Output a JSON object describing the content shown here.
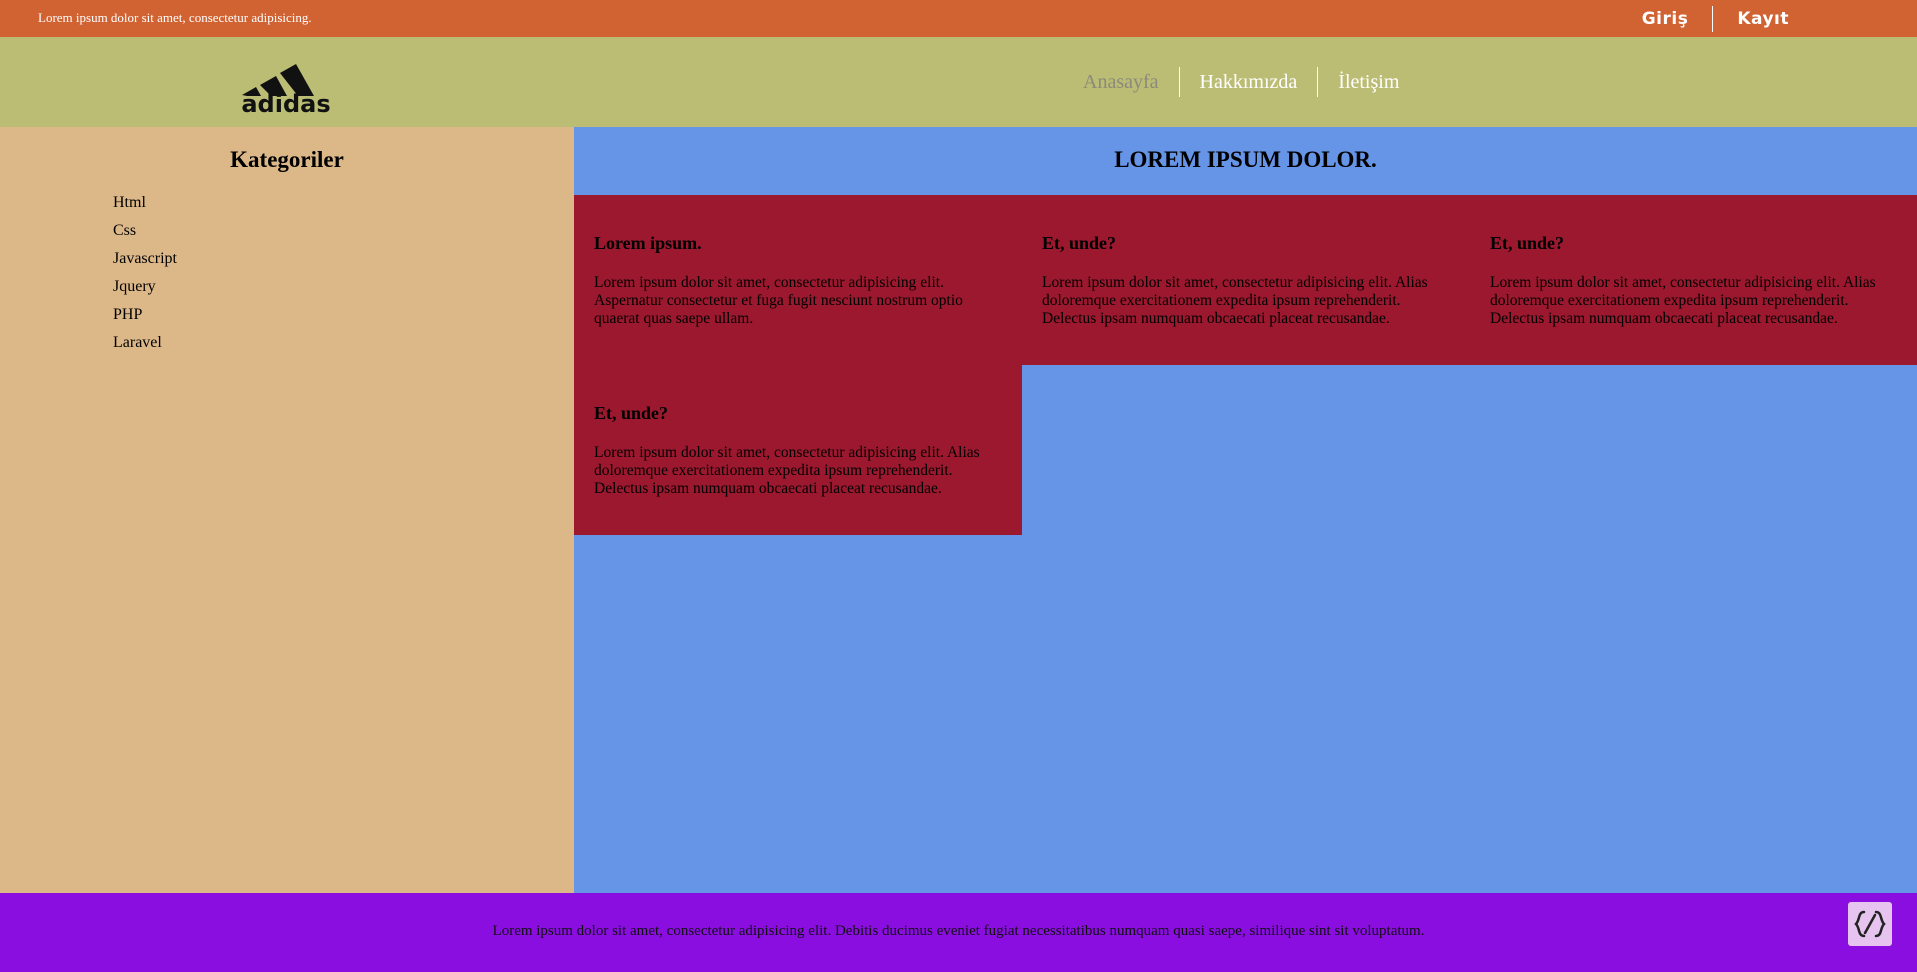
{
  "topbar": {
    "message": "Lorem ipsum dolor sit amet, consectetur adipisicing.",
    "login": "Giriş",
    "register": "Kayıt"
  },
  "header": {
    "logo_text": "adidas",
    "nav": [
      "Anasayfa",
      "Hakkımızda",
      "İletişim"
    ]
  },
  "sidebar": {
    "title": "Kategoriler",
    "items": [
      "Html",
      "Css",
      "Javascript",
      "Jquery",
      "PHP",
      "Laravel"
    ]
  },
  "main": {
    "title": "LOREM IPSUM DOLOR.",
    "cards": [
      {
        "title": "Lorem ipsum.",
        "text": "Lorem ipsum dolor sit amet, consectetur adipisicing elit. Aspernatur consectetur et fuga fugit nesciunt nostrum optio quaerat quas saepe ullam."
      },
      {
        "title": "Et, unde?",
        "text": "Lorem ipsum dolor sit amet, consectetur adipisicing elit. Alias doloremque exercitationem expedita ipsum reprehenderit. Delectus ipsam numquam obcaecati placeat recusandae."
      },
      {
        "title": "Et, unde?",
        "text": "Lorem ipsum dolor sit amet, consectetur adipisicing elit. Alias doloremque exercitationem expedita ipsum reprehenderit. Delectus ipsam numquam obcaecati placeat recusandae."
      },
      {
        "title": "Et, unde?",
        "text": "Lorem ipsum dolor sit amet, consectetur adipisicing elit. Alias doloremque exercitationem expedita ipsum reprehenderit. Delectus ipsam numquam obcaecati placeat recusandae."
      }
    ]
  },
  "footer": {
    "text": "Lorem ipsum dolor sit amet, consectetur adipisicing elit. Debitis ducimus eveniet fugiat necessitatibus numquam quasi saepe, similique sint sit voluptatum."
  },
  "colors": {
    "topbar": "#d16232",
    "header": "#bcbd74",
    "sidebar": "#dcb889",
    "main": "#6694e6",
    "card": "#9b182f",
    "footer": "#8a0ee0"
  }
}
